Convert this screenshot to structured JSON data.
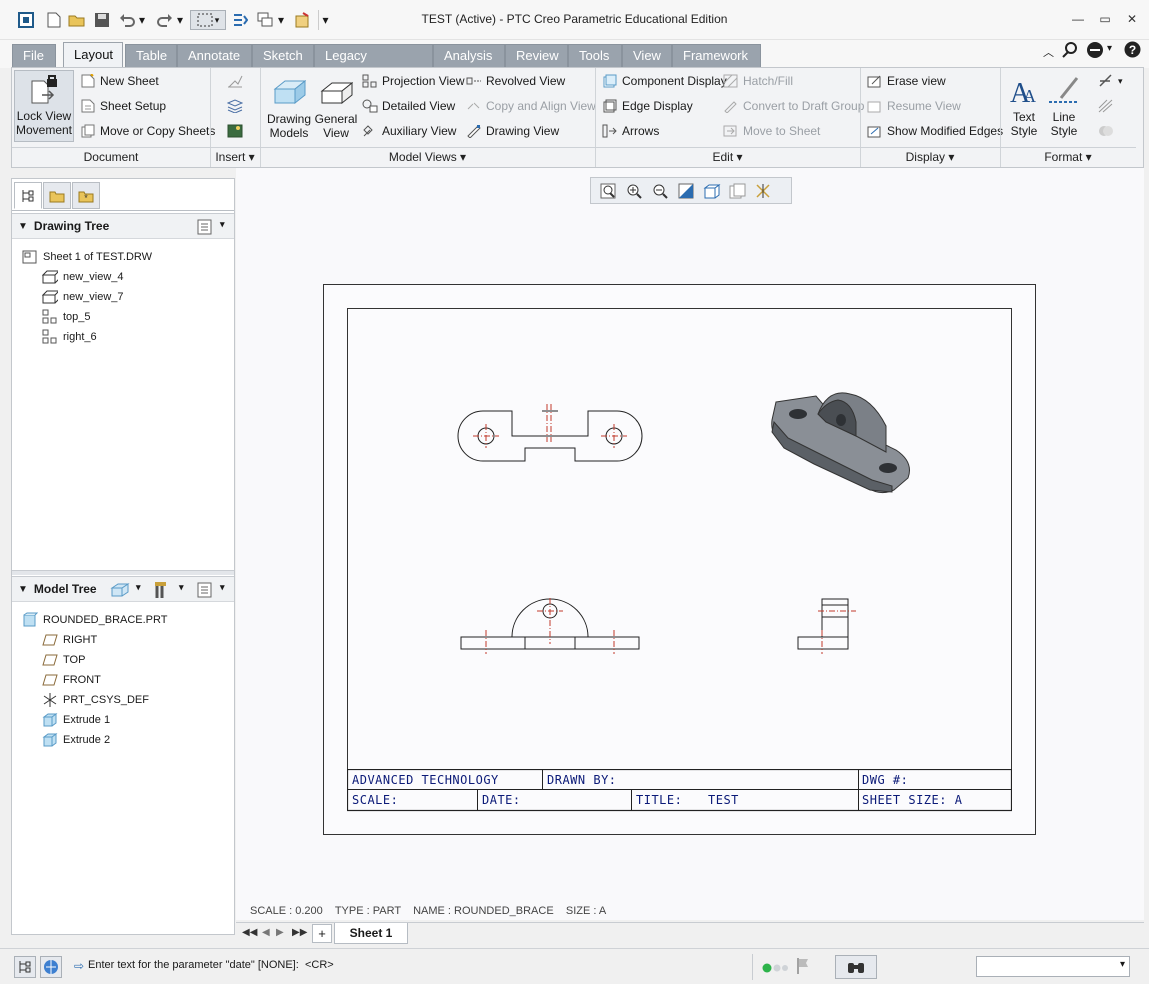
{
  "window": {
    "title": "TEST (Active) - PTC Creo Parametric Educational Edition"
  },
  "tabs": [
    {
      "label": "File"
    },
    {
      "label": "Layout"
    },
    {
      "label": "Table"
    },
    {
      "label": "Annotate"
    },
    {
      "label": "Sketch"
    },
    {
      "label": "Legacy Migration"
    },
    {
      "label": "Analysis"
    },
    {
      "label": "Review"
    },
    {
      "label": "Tools"
    },
    {
      "label": "View"
    },
    {
      "label": "Framework"
    }
  ],
  "ribbon": {
    "document": {
      "group_label": "Document",
      "lock_view": "Lock View\nMovement",
      "new_sheet": "New Sheet",
      "sheet_setup": "Sheet Setup",
      "move_copy": "Move or Copy Sheets"
    },
    "insert": {
      "group_label": "Insert"
    },
    "model_views": {
      "group_label": "Model Views",
      "drawing_models": "Drawing\nModels",
      "general_view": "General\nView",
      "projection_view": "Projection View",
      "detailed_view": "Detailed View",
      "auxiliary_view": "Auxiliary View",
      "revolved_view": "Revolved View",
      "copy_align_view": "Copy and Align View",
      "drawing_view": "Drawing View"
    },
    "edit": {
      "group_label": "Edit",
      "component_display": "Component Display",
      "edge_display": "Edge Display",
      "arrows": "Arrows",
      "hatch_fill": "Hatch/Fill",
      "convert_draft": "Convert to Draft Group",
      "move_to_sheet": "Move to Sheet"
    },
    "display": {
      "group_label": "Display",
      "erase_view": "Erase view",
      "resume_view": "Resume View",
      "show_modified": "Show Modified Edges"
    },
    "format": {
      "group_label": "Format",
      "text_style": "Text\nStyle",
      "line_style": "Line\nStyle"
    }
  },
  "drawing_tree": {
    "title": "Drawing Tree",
    "items": [
      {
        "label": "Sheet 1 of TEST.DRW"
      },
      {
        "label": "new_view_4"
      },
      {
        "label": "new_view_7"
      },
      {
        "label": "top_5"
      },
      {
        "label": "right_6"
      }
    ]
  },
  "model_tree": {
    "title": "Model Tree",
    "items": [
      {
        "label": "ROUNDED_BRACE.PRT"
      },
      {
        "label": "RIGHT"
      },
      {
        "label": "TOP"
      },
      {
        "label": "FRONT"
      },
      {
        "label": "PRT_CSYS_DEF"
      },
      {
        "label": "Extrude 1"
      },
      {
        "label": "Extrude 2"
      }
    ]
  },
  "title_block": {
    "company": "ADVANCED TECHNOLOGY",
    "drawn_by": "DRAWN BY:",
    "dwg_no": "DWG #:",
    "scale": "SCALE:",
    "date": "DATE:",
    "title_label": "TITLE:",
    "title_value": "TEST",
    "sheet_size": "SHEET SIZE: A"
  },
  "info_line": {
    "scale": "SCALE : 0.200",
    "type": "TYPE : PART",
    "name": "NAME : ROUNDED_BRACE",
    "size": "SIZE : A"
  },
  "sheet_tabs": {
    "add": "+",
    "active": "Sheet 1"
  },
  "status": {
    "message": "Enter text for the parameter \"date\" [NONE]:",
    "cr": "<CR>"
  },
  "colors": {
    "accent": "#0b1a78",
    "tab_inactive": "#9aa3ad",
    "centerline": "#c0392b"
  }
}
